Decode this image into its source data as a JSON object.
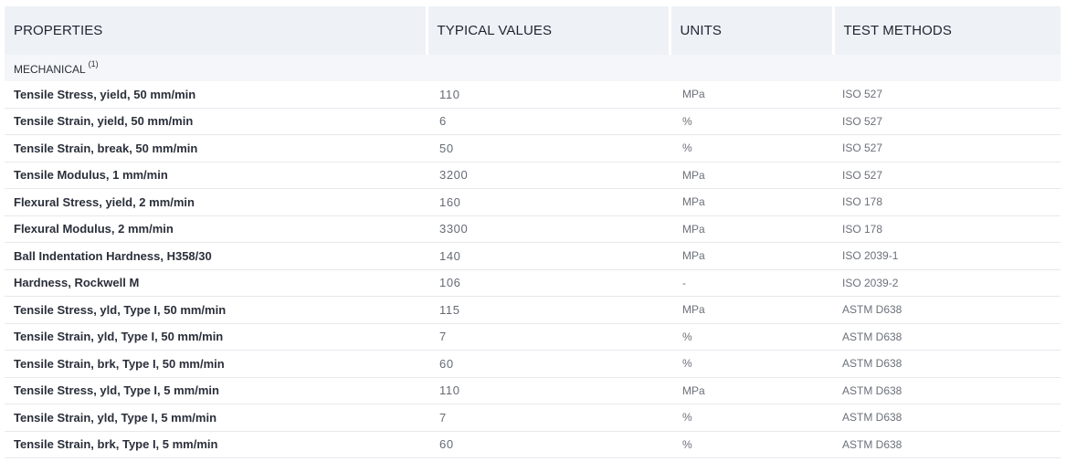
{
  "headers": {
    "properties": "PROPERTIES",
    "typical_values": "TYPICAL VALUES",
    "units": "UNITS",
    "test_methods": "TEST METHODS"
  },
  "section": {
    "label": "MECHANICAL",
    "footnote": "(1)"
  },
  "rows": [
    {
      "property": "Tensile Stress, yield, 50 mm/min",
      "value": "110",
      "unit": "MPa",
      "method": "ISO 527"
    },
    {
      "property": "Tensile Strain, yield, 50 mm/min",
      "value": "6",
      "unit": "%",
      "method": "ISO 527"
    },
    {
      "property": "Tensile Strain, break, 50 mm/min",
      "value": "50",
      "unit": "%",
      "method": "ISO 527"
    },
    {
      "property": "Tensile Modulus, 1 mm/min",
      "value": "3200",
      "unit": "MPa",
      "method": "ISO 527"
    },
    {
      "property": "Flexural Stress, yield, 2 mm/min",
      "value": "160",
      "unit": "MPa",
      "method": "ISO 178"
    },
    {
      "property": "Flexural Modulus, 2 mm/min",
      "value": "3300",
      "unit": "MPa",
      "method": "ISO 178"
    },
    {
      "property": "Ball Indentation Hardness, H358/30",
      "value": "140",
      "unit": "MPa",
      "method": "ISO 2039-1"
    },
    {
      "property": "Hardness, Rockwell M",
      "value": "106",
      "unit": "-",
      "method": "ISO 2039-2"
    },
    {
      "property": "Tensile Stress, yld, Type I, 50 mm/min",
      "value": "115",
      "unit": "MPa",
      "method": "ASTM D638"
    },
    {
      "property": "Tensile Strain, yld, Type I, 50 mm/min",
      "value": "7",
      "unit": "%",
      "method": "ASTM D638"
    },
    {
      "property": "Tensile Strain, brk, Type I, 50 mm/min",
      "value": "60",
      "unit": "%",
      "method": "ASTM D638"
    },
    {
      "property": "Tensile Stress, yld, Type I, 5 mm/min",
      "value": "110",
      "unit": "MPa",
      "method": "ASTM D638"
    },
    {
      "property": "Tensile Strain, yld, Type I, 5 mm/min",
      "value": "7",
      "unit": "%",
      "method": "ASTM D638"
    },
    {
      "property": "Tensile Strain, brk, Type I, 5 mm/min",
      "value": "60",
      "unit": "%",
      "method": "ASTM D638"
    }
  ]
}
